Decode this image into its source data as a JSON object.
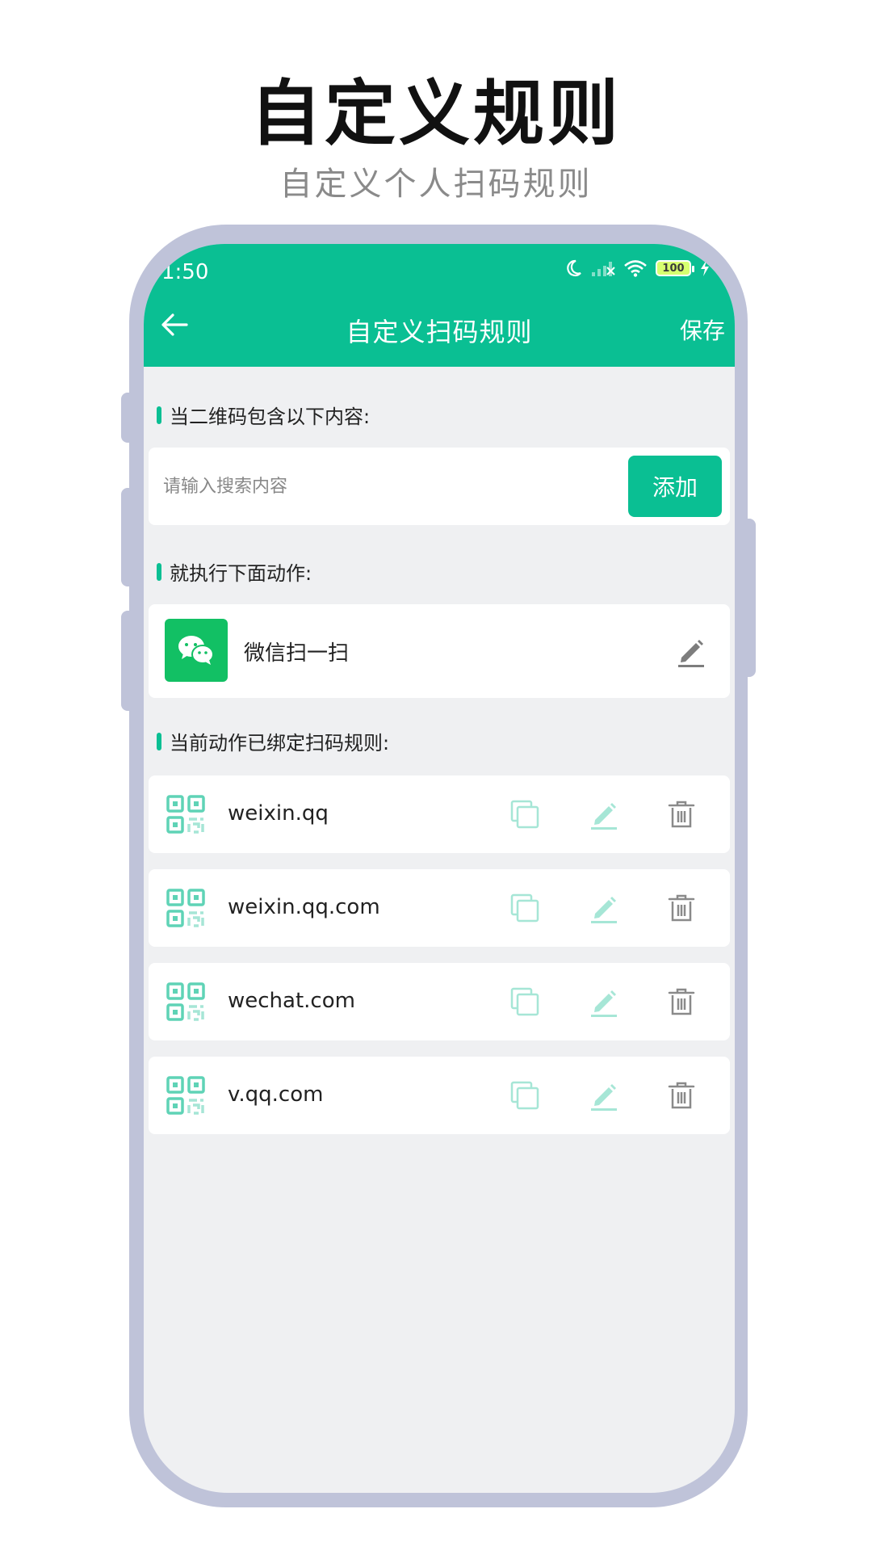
{
  "promo": {
    "title": "自定义规则",
    "subtitle": "自定义个人扫码规则"
  },
  "status_bar": {
    "time": "1:50",
    "battery": "100"
  },
  "nav": {
    "title": "自定义扫码规则",
    "save_label": "保存"
  },
  "sections": {
    "contains_label": "当二维码包含以下内容:",
    "action_label": "就执行下面动作:",
    "bound_label": "当前动作已绑定扫码规则:"
  },
  "search": {
    "placeholder": "请输入搜索内容",
    "value": "",
    "add_label": "添加"
  },
  "action": {
    "name": "微信扫一扫",
    "icon": "wechat-icon"
  },
  "rules": [
    {
      "text": "weixin.qq"
    },
    {
      "text": "weixin.qq.com"
    },
    {
      "text": "wechat.com"
    },
    {
      "text": "v.qq.com"
    }
  ],
  "colors": {
    "accent": "#0abf93",
    "wechat": "#12c064",
    "frame": "#bfc3d9",
    "background": "#eff0f2",
    "icon_light": "#a6e6d6"
  }
}
